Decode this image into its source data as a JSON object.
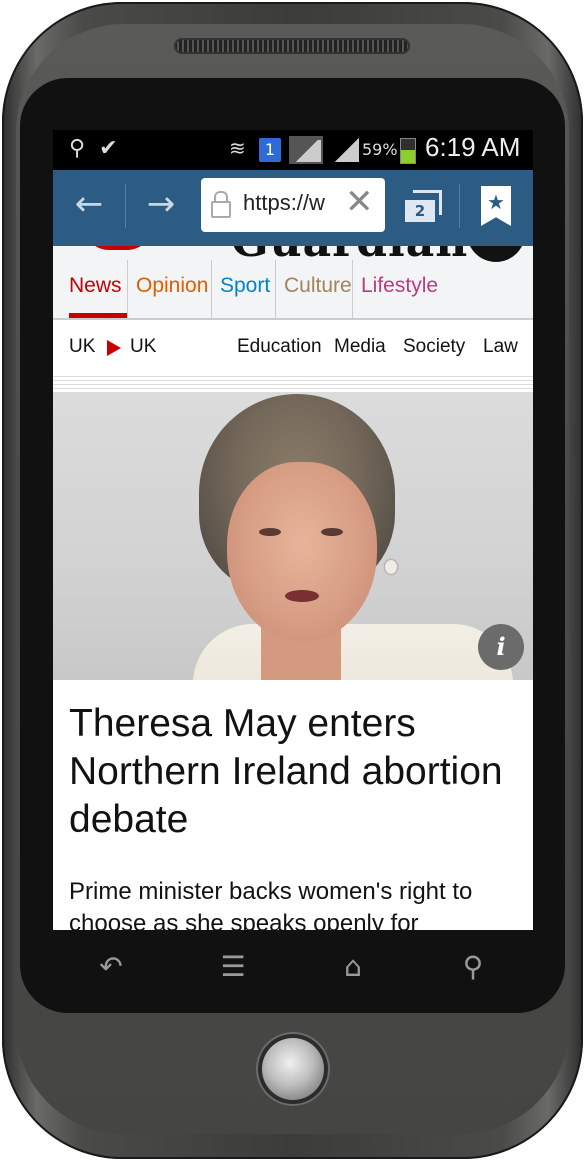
{
  "status_bar": {
    "battery_percent": "59%",
    "time": "6:19 AM",
    "sim_badge": "1",
    "icons": [
      "usb-icon",
      "download-check-icon",
      "wifi-icon",
      "signal-icon",
      "battery-charging-icon"
    ]
  },
  "browser": {
    "url": "https://w",
    "tab_count": "2",
    "toolbar_color": "#2c5b84"
  },
  "site": {
    "logo": "Guardian",
    "pillars": [
      {
        "label": "News",
        "color": "#c70000"
      },
      {
        "label": "Opinion",
        "color": "#e05e00"
      },
      {
        "label": "Sport",
        "color": "#0084c6"
      },
      {
        "label": "Culture",
        "color": "#a1845c"
      },
      {
        "label": "Lifestyle",
        "color": "#bb3b80"
      }
    ],
    "subnav": {
      "section": "UK",
      "current": "UK",
      "links": [
        "Education",
        "Media",
        "Society",
        "Law"
      ]
    }
  },
  "article": {
    "headline": "Theresa May enters Northern Ireland abortion debate",
    "standfirst": "Prime minister backs women's right to choose as she speaks openly for",
    "image_info_label": "i"
  },
  "softkeys": [
    "back-icon",
    "menu-icon",
    "home-icon",
    "search-icon"
  ]
}
